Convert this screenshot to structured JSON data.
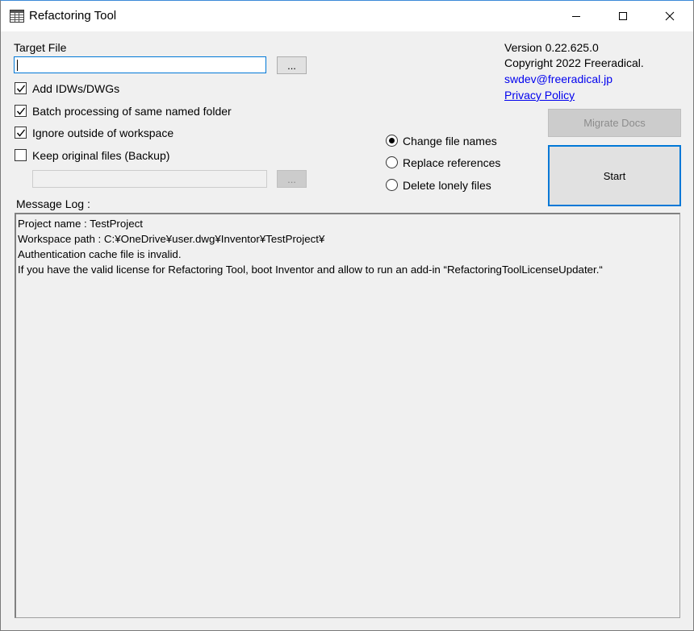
{
  "window": {
    "title": "Refactoring Tool",
    "icon": "table-icon"
  },
  "form": {
    "target_file_label": "Target File",
    "target_file_value": "",
    "browse_label": "...",
    "backup_browse_label": "...",
    "backup_path_value": "",
    "checkboxes": [
      {
        "label": "Add IDWs/DWGs",
        "checked": true
      },
      {
        "label": "Batch processing of same named folder",
        "checked": true
      },
      {
        "label": "Ignore outside of workspace",
        "checked": true
      },
      {
        "label": "Keep original files (Backup)",
        "checked": false
      }
    ],
    "radios": [
      {
        "label": "Change file names",
        "selected": true
      },
      {
        "label": "Replace references",
        "selected": false
      },
      {
        "label": "Delete lonely files",
        "selected": false
      }
    ],
    "message_log_label": "Message Log :"
  },
  "about": {
    "version": "Version 0.22.625.0",
    "copyright": "Copyright 2022 Freeradical.",
    "email": "swdev@freeradical.jp",
    "privacy": "Privacy Policy"
  },
  "actions": {
    "migrate_label": "Migrate Docs",
    "start_label": "Start"
  },
  "log": {
    "lines": [
      "Project name : TestProject",
      "Workspace path : C:¥OneDrive¥user.dwg¥Inventor¥TestProject¥",
      "Authentication cache file is invalid.",
      "If you have the valid license for Refactoring Tool, boot Inventor and allow to run an add-in “RefactoringToolLicenseUpdater.“"
    ]
  }
}
